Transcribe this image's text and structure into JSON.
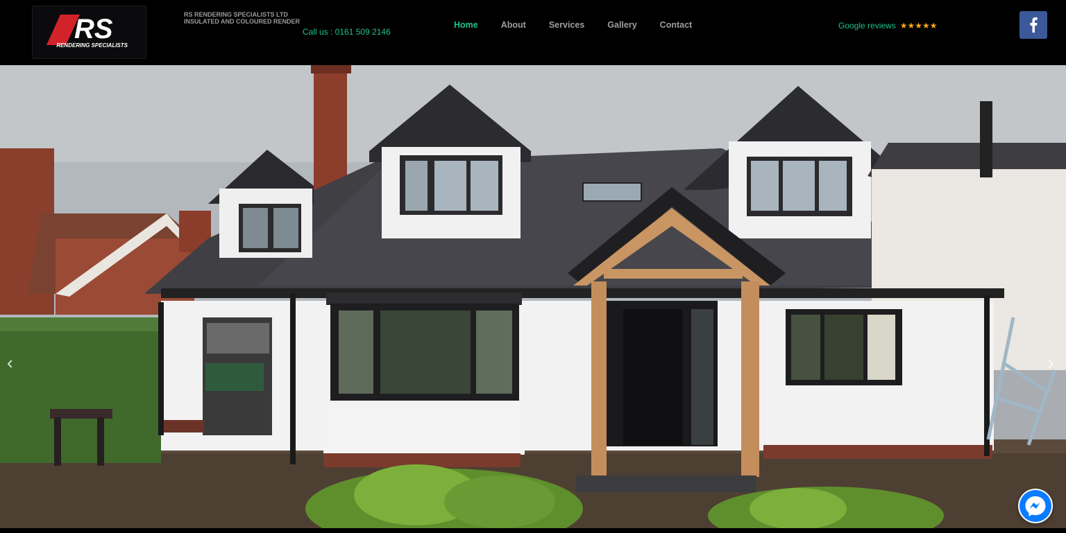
{
  "header": {
    "logo": {
      "text": "RS",
      "subtitle": "RENDERING SPECIALISTS"
    },
    "company_line1": "RS RENDERING SPECIALISTS LTD",
    "company_line2": "INSULATED AND COLOURED RENDER",
    "phone": "Call us : 0161 509 2146",
    "nav": [
      {
        "label": "Home",
        "active": true
      },
      {
        "label": "About"
      },
      {
        "label": "Services"
      },
      {
        "label": "Gallery"
      },
      {
        "label": "Contact"
      }
    ],
    "reviews_label": "Google reviews",
    "reviews_stars": "★★★★★",
    "social_icon": "facebook-icon"
  },
  "slider": {
    "prev_arrow": "‹",
    "next_arrow": "›",
    "image": "house-photo"
  },
  "chat": {
    "icon": "messenger-icon"
  },
  "colors": {
    "accent": "#1ec38c",
    "nav_text": "#9e9e9e",
    "facebook": "#3b5998",
    "stars": "#f5a623"
  }
}
